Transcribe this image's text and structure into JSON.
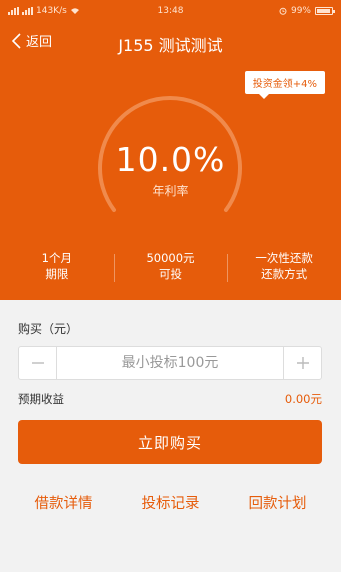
{
  "status_bar": {
    "network_speed": "143K/s",
    "time": "13:48",
    "battery": "99%",
    "icons": [
      "signal-icon",
      "wifi-icon",
      "alarm-icon",
      "battery-icon"
    ]
  },
  "nav": {
    "back_label": "返回",
    "title": "J155 测试测试"
  },
  "hero": {
    "bonus_tag": "投资金领+4%",
    "rate": "10.0%",
    "rate_label": "年利率",
    "stats": [
      {
        "value": "1个月",
        "label": "期限"
      },
      {
        "value": "50000元",
        "label": "可投"
      },
      {
        "value": "一次性还款",
        "label": "还款方式"
      }
    ]
  },
  "purchase": {
    "label": "购买（元）",
    "amount_placeholder": "最小投标100元",
    "amount_value": "",
    "expected_income_label": "预期收益",
    "expected_income_value": "0.00元",
    "buy_button": "立即购买"
  },
  "links": {
    "loan_details": "借款详情",
    "bid_records": "投标记录",
    "repayment_plan": "回款计划"
  },
  "colors": {
    "brand": "#e65c0b",
    "background": "#f2f2f2",
    "white": "#ffffff"
  }
}
